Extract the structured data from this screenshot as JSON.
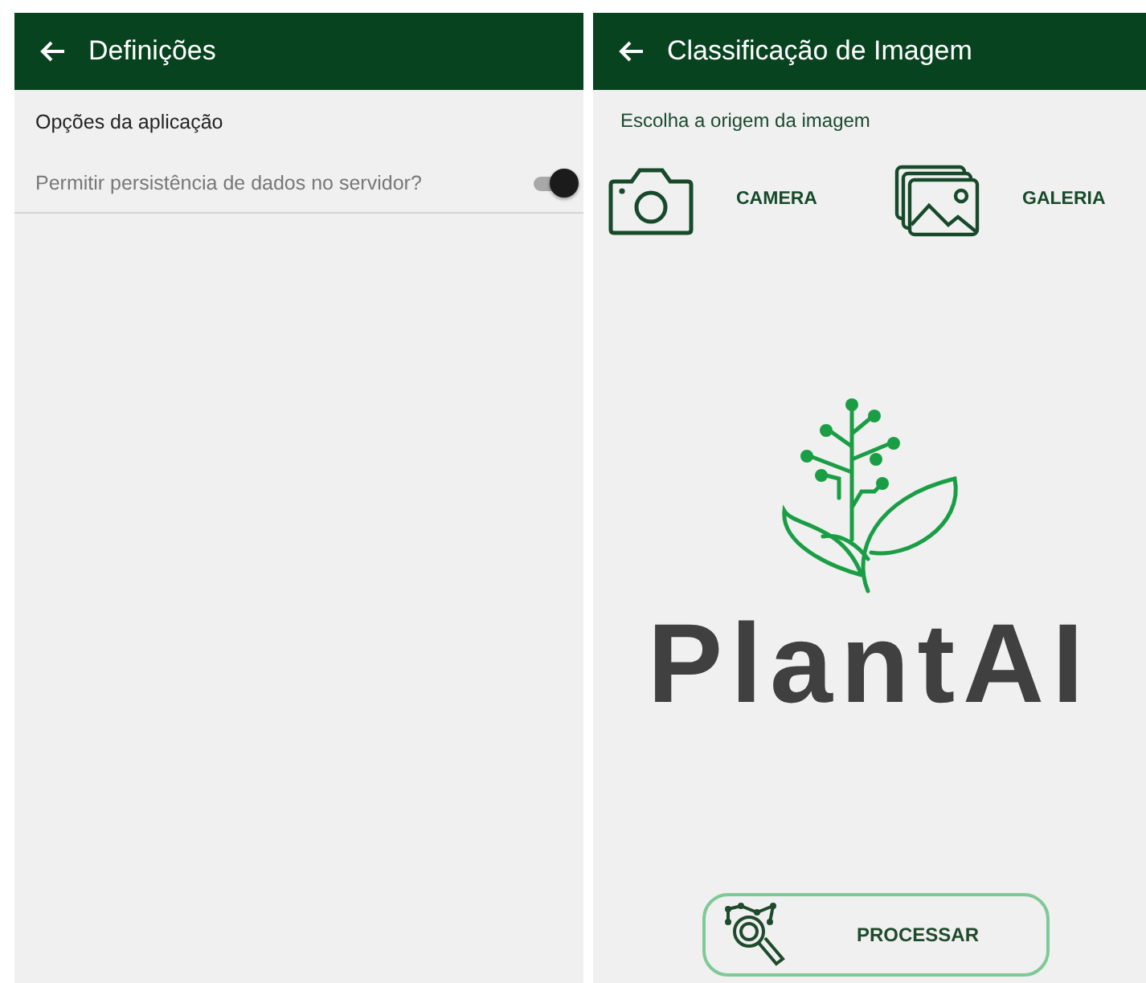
{
  "settings_screen": {
    "title": "Definições",
    "section_title": "Opções da aplicação",
    "options": [
      {
        "label": "Permitir persistência de dados no servidor?",
        "on": true
      }
    ]
  },
  "classification_screen": {
    "title": "Classificação de Imagem",
    "prompt": "Escolha a origem da imagem",
    "sources": [
      {
        "kind": "camera",
        "label": "CAMERA"
      },
      {
        "kind": "gallery",
        "label": "GALERIA"
      }
    ],
    "logo_text": "PlantAI",
    "process_button": "PROCESSAR"
  }
}
